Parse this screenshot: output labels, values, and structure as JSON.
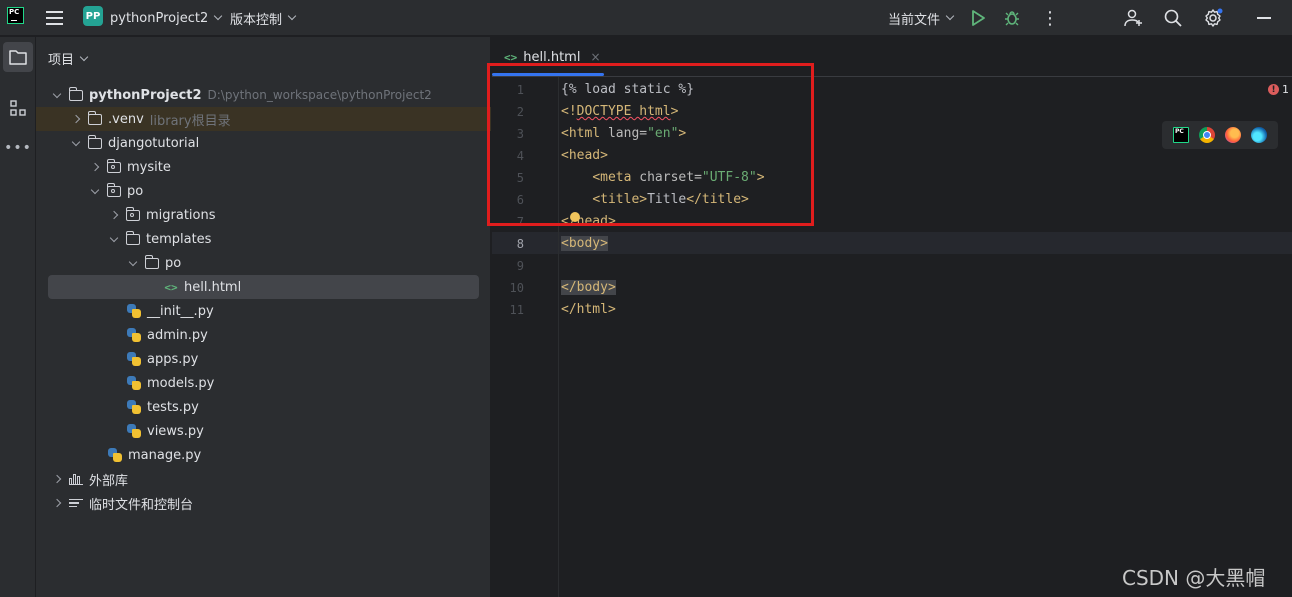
{
  "titlebar": {
    "logo_text": "PC",
    "project_badge": "PP",
    "project_name": "pythonProject2",
    "vcs_label": "版本控制",
    "run_config": "当前文件",
    "more_label": "⋮"
  },
  "activity_bar": {
    "more_label": "•••"
  },
  "project_panel": {
    "header": "项目",
    "tree": [
      {
        "label": "pythonProject2",
        "hint": "D:\\python_workspace\\pythonProject2"
      },
      {
        "label": ".venv",
        "hint": "library根目录"
      },
      {
        "label": "djangotutorial"
      },
      {
        "label": "mysite"
      },
      {
        "label": "po"
      },
      {
        "label": "migrations"
      },
      {
        "label": "templates"
      },
      {
        "label": "po"
      },
      {
        "label": "hell.html"
      },
      {
        "label": "__init__.py"
      },
      {
        "label": "admin.py"
      },
      {
        "label": "apps.py"
      },
      {
        "label": "models.py"
      },
      {
        "label": "tests.py"
      },
      {
        "label": "views.py"
      },
      {
        "label": "manage.py"
      },
      {
        "label": "外部库"
      },
      {
        "label": "临时文件和控制台"
      }
    ]
  },
  "editor": {
    "tab_label": "hell.html",
    "tab_close": "×",
    "error_count": "1",
    "error_icon": "!",
    "current_line": 8,
    "line_numbers": [
      "1",
      "2",
      "3",
      "4",
      "5",
      "6",
      "7",
      "8",
      "9",
      "10",
      "11"
    ],
    "code": {
      "l1": "{% load static %}",
      "l2_open": "<!",
      "l2_doctype": "DOCTYPE html",
      "l2_close": ">",
      "l3_open": "<html ",
      "l3_attr": "lang=",
      "l3_val": "\"en\"",
      "l3_close": ">",
      "l4": "<head>",
      "l5_indent": "    ",
      "l5_open": "<meta ",
      "l5_attr": "charset=",
      "l5_val": "\"UTF-8\"",
      "l5_close": ">",
      "l6_indent": "    ",
      "l6_open": "<title>",
      "l6_text": "Title",
      "l6_close": "</title>",
      "l7": "</head>",
      "l8": "<body>",
      "l10": "</body>",
      "l11": "</html>"
    }
  },
  "browser_icons": [
    "pycharm-icon",
    "chrome-icon",
    "firefox-icon",
    "edge-icon"
  ],
  "watermark": "CSDN @大黑帽",
  "colors": {
    "accent": "#3574f0",
    "highlight_box": "#e01d1d",
    "tag": "#d5b778",
    "string": "#6aab73"
  }
}
